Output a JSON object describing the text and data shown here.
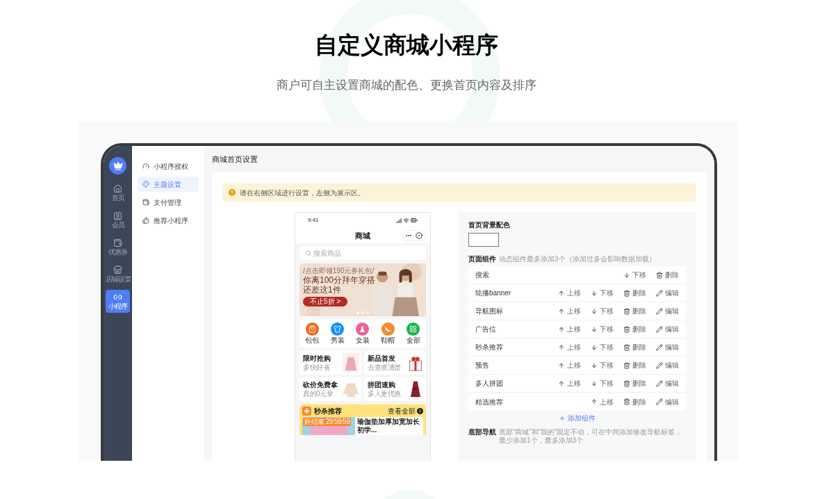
{
  "hero": {
    "title": "自定义商城小程序",
    "subtitle": "商户可自主设置商城的配色、更换首页内容及排序"
  },
  "app": {
    "rail": [
      {
        "label": "首页",
        "selected": false
      },
      {
        "label": "会员",
        "selected": false
      },
      {
        "label": "优惠券",
        "selected": false
      },
      {
        "label": "店铺设置",
        "selected": false
      },
      {
        "label": "小程序",
        "selected": true
      }
    ],
    "menu": [
      {
        "label": "小程序授权",
        "selected": false
      },
      {
        "label": "主题设置",
        "selected": true
      },
      {
        "label": "支付管理",
        "selected": false
      },
      {
        "label": "推荐小程序",
        "selected": false
      }
    ],
    "header": "商城首页设置",
    "notice": "请在右侧区域进行设置，左侧为展示区。",
    "phone": {
      "time": "9:41",
      "title": "商城",
      "search_placeholder": "搜索商品",
      "banner": {
        "tag": "/点击即领190元券礼包/",
        "headline": [
          "你离100分拜年穿搭",
          "还差这1件"
        ],
        "button": "不止5折 >",
        "slides": [
          {
            "selected": true
          },
          {
            "selected": false
          },
          {
            "selected": false
          }
        ]
      },
      "categories": [
        {
          "label": "包包",
          "color": "#f26a1b"
        },
        {
          "label": "男装",
          "color": "#1890ff"
        },
        {
          "label": "女装",
          "color": "#f0609a"
        },
        {
          "label": "鞋帽",
          "color": "#f5892b"
        },
        {
          "label": "全部",
          "color": "#1bb448"
        }
      ],
      "promos": [
        {
          "title": "限时抢购",
          "subtitle": "多快好省"
        },
        {
          "title": "新品首发",
          "subtitle": "去查查清楚"
        },
        {
          "title": "砍价免费拿",
          "subtitle": "真的0元拿"
        },
        {
          "title": "拼团速购",
          "subtitle": "多人更优惠"
        }
      ],
      "flash": {
        "title": "秒杀推荐",
        "more": "查看全部",
        "countdown_label": "距结束",
        "countdown": "29:59:59",
        "product": "瑜伽垫加厚加宽加长初学..."
      }
    },
    "settings": {
      "bg_label": "首页背景配色",
      "components_label": "页面组件",
      "components_hint": "动态组件最多添加3个（添加过多会影响数据加载）",
      "components": [
        {
          "name": "搜索",
          "actions": [
            {
              "kind": "down",
              "label": "下移"
            },
            {
              "kind": "delete",
              "label": "删除"
            }
          ]
        },
        {
          "name": "轮播banner",
          "actions": [
            {
              "kind": "up",
              "label": "上移"
            },
            {
              "kind": "down",
              "label": "下移"
            },
            {
              "kind": "delete",
              "label": "删除"
            },
            {
              "kind": "edit",
              "label": "编辑"
            }
          ]
        },
        {
          "name": "导航图标",
          "actions": [
            {
              "kind": "up",
              "label": "上移"
            },
            {
              "kind": "down",
              "label": "下移"
            },
            {
              "kind": "delete",
              "label": "删除"
            },
            {
              "kind": "edit",
              "label": "编辑"
            }
          ]
        },
        {
          "name": "广告位",
          "actions": [
            {
              "kind": "up",
              "label": "上移"
            },
            {
              "kind": "down",
              "label": "下移"
            },
            {
              "kind": "delete",
              "label": "删除"
            },
            {
              "kind": "edit",
              "label": "编辑"
            }
          ]
        },
        {
          "name": "秒杀推荐",
          "actions": [
            {
              "kind": "up",
              "label": "上移"
            },
            {
              "kind": "down",
              "label": "下移"
            },
            {
              "kind": "delete",
              "label": "删除"
            },
            {
              "kind": "edit",
              "label": "编辑"
            }
          ]
        },
        {
          "name": "预售",
          "actions": [
            {
              "kind": "up",
              "label": "上移"
            },
            {
              "kind": "down",
              "label": "下移"
            },
            {
              "kind": "delete",
              "label": "删除"
            },
            {
              "kind": "edit",
              "label": "编辑"
            }
          ]
        },
        {
          "name": "多人拼团",
          "actions": [
            {
              "kind": "up",
              "label": "上移"
            },
            {
              "kind": "down",
              "label": "下移"
            },
            {
              "kind": "delete",
              "label": "删除"
            },
            {
              "kind": "edit",
              "label": "编辑"
            }
          ]
        },
        {
          "name": "精选推荐",
          "actions": [
            {
              "kind": "up",
              "label": "上移"
            },
            {
              "kind": "delete",
              "label": "删除"
            },
            {
              "kind": "edit",
              "label": "编辑"
            }
          ]
        }
      ],
      "add_label": "添加组件",
      "bottom_nav_label": "底部导航",
      "bottom_nav_hint": "底部“商城”和“我的”固定不动，可在中间添加修改导航标签，最少添加1个，最多添加3个"
    }
  }
}
